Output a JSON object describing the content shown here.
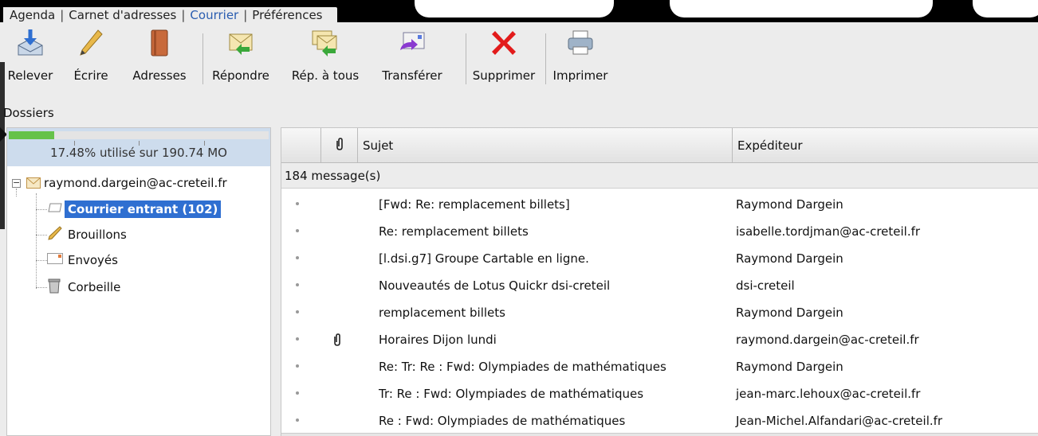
{
  "nav": {
    "links": [
      {
        "label": "Agenda",
        "active": false
      },
      {
        "label": "Carnet d'adresses",
        "active": false
      },
      {
        "label": "Courrier",
        "active": true
      },
      {
        "label": "Préférences",
        "active": false
      }
    ],
    "separator": "|"
  },
  "toolbar": {
    "buttons": [
      {
        "label": "Relever",
        "icon": "fetch-mail-icon"
      },
      {
        "label": "Écrire",
        "icon": "pencil-icon"
      },
      {
        "label": "Adresses",
        "icon": "address-book-icon"
      },
      {
        "label": "Répondre",
        "icon": "reply-icon"
      },
      {
        "label": "Rép. à tous",
        "icon": "reply-all-icon"
      },
      {
        "label": "Transférer",
        "icon": "forward-icon"
      },
      {
        "label": "Supprimer",
        "icon": "delete-x-icon"
      },
      {
        "label": "Imprimer",
        "icon": "printer-icon"
      }
    ]
  },
  "dossiers": {
    "title": "Dossiers",
    "quota": {
      "text": "17.48% utilisé sur 190.74 MO",
      "fraction": 0.1748
    },
    "account": {
      "label": "raymond.dargein@ac-creteil.fr",
      "icon": "envelope-icon",
      "expander": "−"
    },
    "folders": [
      {
        "label": "Courrier entrant (102)",
        "icon": "inbox-tray-icon",
        "selected": true
      },
      {
        "label": "Brouillons",
        "icon": "pencil-icon",
        "selected": false
      },
      {
        "label": "Envoyés",
        "icon": "sent-envelope-icon",
        "selected": false
      },
      {
        "label": "Corbeille",
        "icon": "trash-can-icon",
        "selected": false
      }
    ]
  },
  "messages": {
    "columns": {
      "attachment_icon": "paperclip-icon",
      "subject": "Sujet",
      "sender": "Expéditeur"
    },
    "count_text": "184 message(s)",
    "rows": [
      {
        "subject": "[Fwd: Re: remplacement billets]",
        "sender": "Raymond Dargein",
        "attachment": false
      },
      {
        "subject": "Re: remplacement billets",
        "sender": "isabelle.tordjman@ac-creteil.fr",
        "attachment": false
      },
      {
        "subject": "[l.dsi.g7] Groupe Cartable en ligne.",
        "sender": "Raymond Dargein",
        "attachment": false
      },
      {
        "subject": "Nouveautés de Lotus Quickr dsi-creteil",
        "sender": "dsi-creteil",
        "attachment": false
      },
      {
        "subject": "remplacement billets",
        "sender": "Raymond Dargein",
        "attachment": false
      },
      {
        "subject": "Horaires Dijon lundi",
        "sender": "raymond.dargein@ac-creteil.fr",
        "attachment": true
      },
      {
        "subject": "Re: Tr: Re : Fwd: Olympiades de mathématiques",
        "sender": "Raymond Dargein",
        "attachment": false
      },
      {
        "subject": "Tr: Re : Fwd: Olympiades de mathématiques",
        "sender": "jean-marc.lehoux@ac-creteil.fr",
        "attachment": false
      },
      {
        "subject": "Re : Fwd: Olympiades de mathématiques",
        "sender": "Jean-Michel.Alfandari@ac-creteil.fr",
        "attachment": false
      }
    ]
  },
  "colors": {
    "selection": "#2f6fd1",
    "active_tab": "#2a5db0",
    "quota_fill": "#66c24a",
    "quota_bg": "#cddced"
  }
}
